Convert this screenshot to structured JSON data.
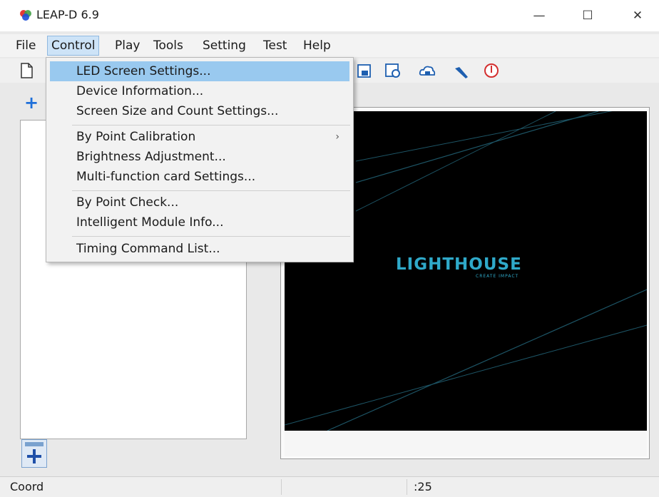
{
  "window": {
    "title": "LEAP-D 6.9",
    "controls": {
      "minimize": "—",
      "maximize": "☐",
      "close": "✕"
    }
  },
  "menubar": {
    "items": [
      "File",
      "Control",
      "Play",
      "Tools",
      "Setting",
      "Test",
      "Help"
    ],
    "active": "Control"
  },
  "control_menu": {
    "items": [
      "LED Screen Settings...",
      "Device Information...",
      "Screen Size and Count Settings...",
      "By Point Calibration",
      "Brightness Adjustment...",
      "Multi-function card Settings...",
      "By Point Check...",
      "Intelligent Module Info...",
      "Timing Command List..."
    ],
    "highlighted": "LED Screen Settings...",
    "submenu_arrow": "›"
  },
  "toolbar": {
    "icons": [
      "new-file-icon",
      "save-icon",
      "settings-icon",
      "cloud-send-icon",
      "tools-icon",
      "stop-icon"
    ]
  },
  "left_panel": {
    "add_tab_glyph": "+",
    "add_area_glyph": "+"
  },
  "preview": {
    "brand": "LIGHTHOUSE",
    "tagline": "CREATE IMPACT"
  },
  "statusbar": {
    "coord_label": "Coord",
    "value": ":25"
  },
  "colors": {
    "highlight": "#99c9ef",
    "menu_active": "#cde3f7",
    "brand": "#2fa9c9",
    "accent_plus": "#1e6fd9"
  }
}
